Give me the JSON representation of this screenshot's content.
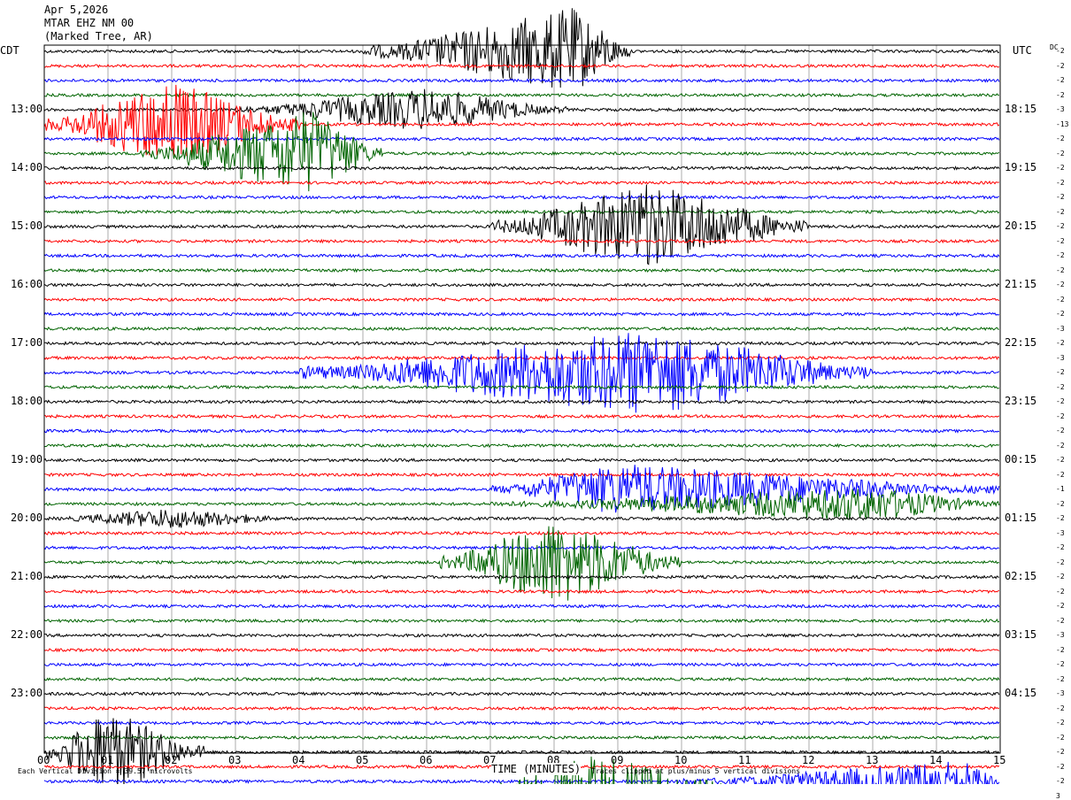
{
  "header": {
    "date": "Apr 5,2026",
    "station": "MTAR EHZ NM 00",
    "location": "(Marked Tree, AR)"
  },
  "axes": {
    "left_tz": "CDT",
    "right_tz": "UTC",
    "dc_label": "DC",
    "xlabel": "TIME (MINUTES)",
    "footer_left": "Each Vertical Division = 39.57 microvolts",
    "footer_right": "Traces clipped at plus/minus 5 vertical divisions"
  },
  "colors": {
    "black": "#000000",
    "red": "#ff0000",
    "blue": "#0000ff",
    "green": "#006400",
    "grid": "#888888"
  },
  "chart_data": {
    "type": "line",
    "title": "MTAR EHZ NM 00",
    "x_ticks": [
      "00",
      "01",
      "02",
      "03",
      "04",
      "05",
      "06",
      "07",
      "08",
      "09",
      "10",
      "11",
      "12",
      "13",
      "14",
      "15"
    ],
    "xlim": [
      0,
      15
    ],
    "trace_colors": [
      "black",
      "red",
      "blue",
      "green"
    ],
    "left_time_labels": [
      "13:00",
      "14:00",
      "15:00",
      "16:00",
      "17:00",
      "18:00",
      "19:00",
      "20:00",
      "21:00",
      "22:00",
      "23:00"
    ],
    "right_time_labels": [
      "18:15",
      "19:15",
      "20:15",
      "21:15",
      "22:15",
      "23:15",
      "00:15",
      "01:15",
      "02:15",
      "03:15",
      "04:15"
    ],
    "dc_offsets": [
      "-2",
      "-2",
      "-2",
      "-2",
      "-3",
      "-13",
      "-2",
      "-2",
      "-2",
      "-2",
      "-2",
      "-2",
      "-2",
      "-2",
      "-2",
      "-2",
      "-2",
      "-2",
      "-2",
      "-3",
      "-2",
      "-3",
      "-2",
      "-2",
      "-2",
      "-2",
      "-2",
      "-2",
      "-2",
      "-2",
      "-1",
      "-2",
      "-2",
      "-3",
      "-2",
      "-2",
      "-2",
      "-2",
      "-2",
      "-2",
      "-3",
      "-2",
      "-2",
      "-2",
      "-3",
      "-2",
      "-2",
      "-2",
      "-2",
      "-2",
      "-2",
      "3"
    ],
    "bursts": [
      {
        "trace": 0,
        "start_min": 5.0,
        "end_min": 9.2,
        "peak_min": 8.3,
        "amp": 5
      },
      {
        "trace": 4,
        "start_min": 3.0,
        "end_min": 8.2,
        "peak_min": 6.0,
        "amp": 2.5
      },
      {
        "trace": 5,
        "start_min": 0.0,
        "end_min": 4.0,
        "peak_min": 2.0,
        "amp": 5
      },
      {
        "trace": 7,
        "start_min": 1.5,
        "end_min": 5.3,
        "peak_min": 4.2,
        "amp": 5
      },
      {
        "trace": 12,
        "start_min": 7.0,
        "end_min": 12.0,
        "peak_min": 9.5,
        "amp": 5
      },
      {
        "trace": 22,
        "start_min": 4.0,
        "end_min": 13.0,
        "peak_min": 9.5,
        "amp": 5
      },
      {
        "trace": 30,
        "start_min": 7.0,
        "end_min": 15.0,
        "peak_min": 9.0,
        "amp": 3
      },
      {
        "trace": 31,
        "start_min": 7.0,
        "end_min": 15.0,
        "peak_min": 13.0,
        "amp": 2
      },
      {
        "trace": 32,
        "start_min": 0.0,
        "end_min": 4.0,
        "peak_min": 2.0,
        "amp": 1.2
      },
      {
        "trace": 35,
        "start_min": 6.2,
        "end_min": 10.0,
        "peak_min": 8.0,
        "amp": 5
      },
      {
        "trace": 48,
        "start_min": 0.0,
        "end_min": 2.5,
        "peak_min": 1.0,
        "amp": 5
      },
      {
        "trace": 51,
        "start_min": 6.5,
        "end_min": 11.5,
        "peak_min": 8.5,
        "amp": 5
      },
      {
        "trace": 50,
        "start_min": 10.0,
        "end_min": 15.0,
        "peak_min": 14.5,
        "amp": 2.5
      }
    ]
  }
}
